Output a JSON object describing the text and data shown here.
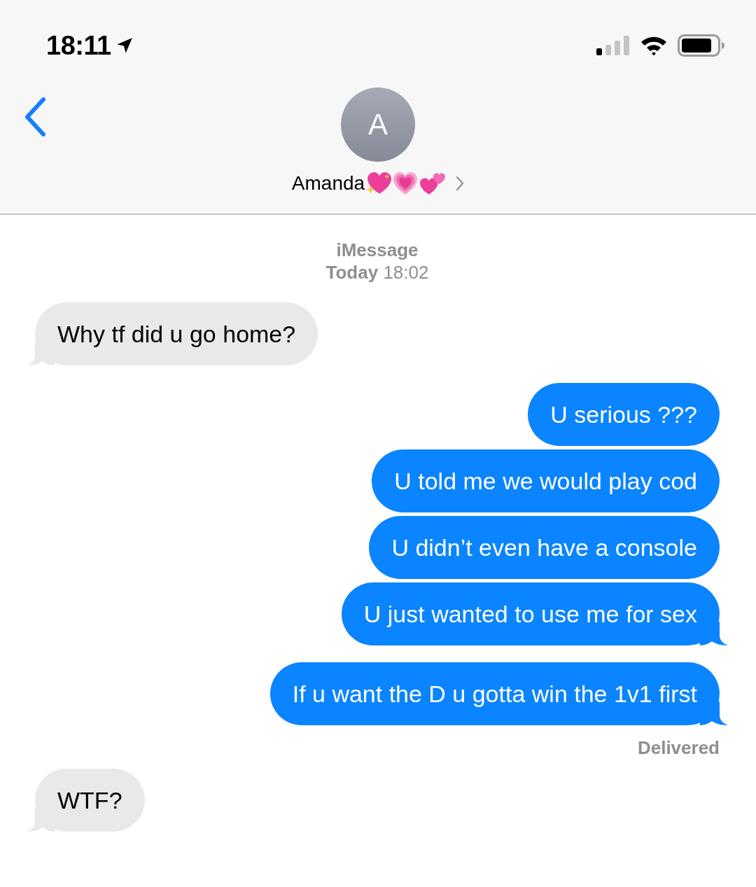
{
  "status_bar": {
    "time": "18:11"
  },
  "contact": {
    "initial": "A",
    "name": "Amanda"
  },
  "thread_info": {
    "service": "iMessage",
    "timestamp": "**Today** 18:02"
  },
  "items": [
    {
      "kind": "received",
      "text": "Why tf did u go home?",
      "tail": true
    },
    {
      "kind": "sent",
      "text": "U serious ???",
      "tail": false
    },
    {
      "kind": "sent",
      "text": "U told me we would play cod",
      "tail": false
    },
    {
      "kind": "sent",
      "text": "U didn’t even have a console",
      "tail": false
    },
    {
      "kind": "sent",
      "text": "U just wanted to use me for sex",
      "tail": true
    },
    {
      "kind": "sent",
      "text": "If u want the D u gotta win the 1v1 first",
      "tail": true
    },
    {
      "kind": "receipt",
      "text": "Delivered"
    },
    {
      "kind": "received",
      "text": "WTF?",
      "tail": true
    }
  ]
}
